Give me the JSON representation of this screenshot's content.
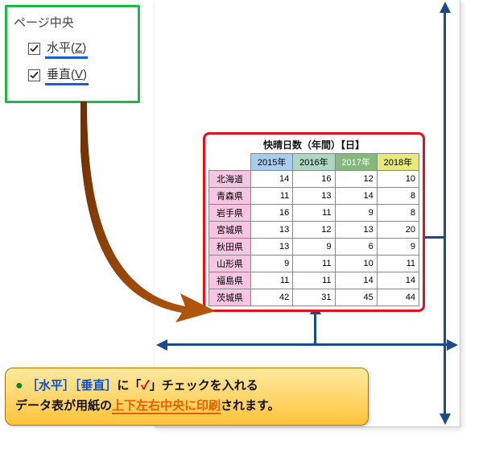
{
  "settings": {
    "group_label": "ページ中央",
    "items": [
      {
        "label": "水平",
        "accesskey": "Z",
        "checked": true
      },
      {
        "label": "垂直",
        "accesskey": "V",
        "checked": true
      }
    ]
  },
  "chart_data": {
    "type": "table",
    "title": "快晴日数（年間）【日】",
    "columns": [
      "2015年",
      "2016年",
      "2017年",
      "2018年"
    ],
    "rows": [
      {
        "name": "北海道",
        "values": [
          14,
          16,
          12,
          10
        ]
      },
      {
        "name": "青森県",
        "values": [
          11,
          13,
          14,
          8
        ]
      },
      {
        "name": "岩手県",
        "values": [
          16,
          11,
          9,
          8
        ]
      },
      {
        "name": "宮城県",
        "values": [
          13,
          12,
          13,
          20
        ]
      },
      {
        "name": "秋田県",
        "values": [
          13,
          9,
          6,
          9
        ]
      },
      {
        "name": "山形県",
        "values": [
          9,
          11,
          10,
          11
        ]
      },
      {
        "name": "福島県",
        "values": [
          11,
          11,
          14,
          14
        ]
      },
      {
        "name": "茨城県",
        "values": [
          42,
          31,
          45,
          44
        ]
      }
    ]
  },
  "callout": {
    "line1_pre": "［",
    "opt1": "水平",
    "mid1": "］［",
    "opt2": "垂直",
    "post1": "］に「",
    "check": "✓",
    "post2": "」チェックを入れる",
    "line2_pre": "データ表が用紙の",
    "emph": "上下左右中央に印刷",
    "line2_post": "されます。"
  }
}
